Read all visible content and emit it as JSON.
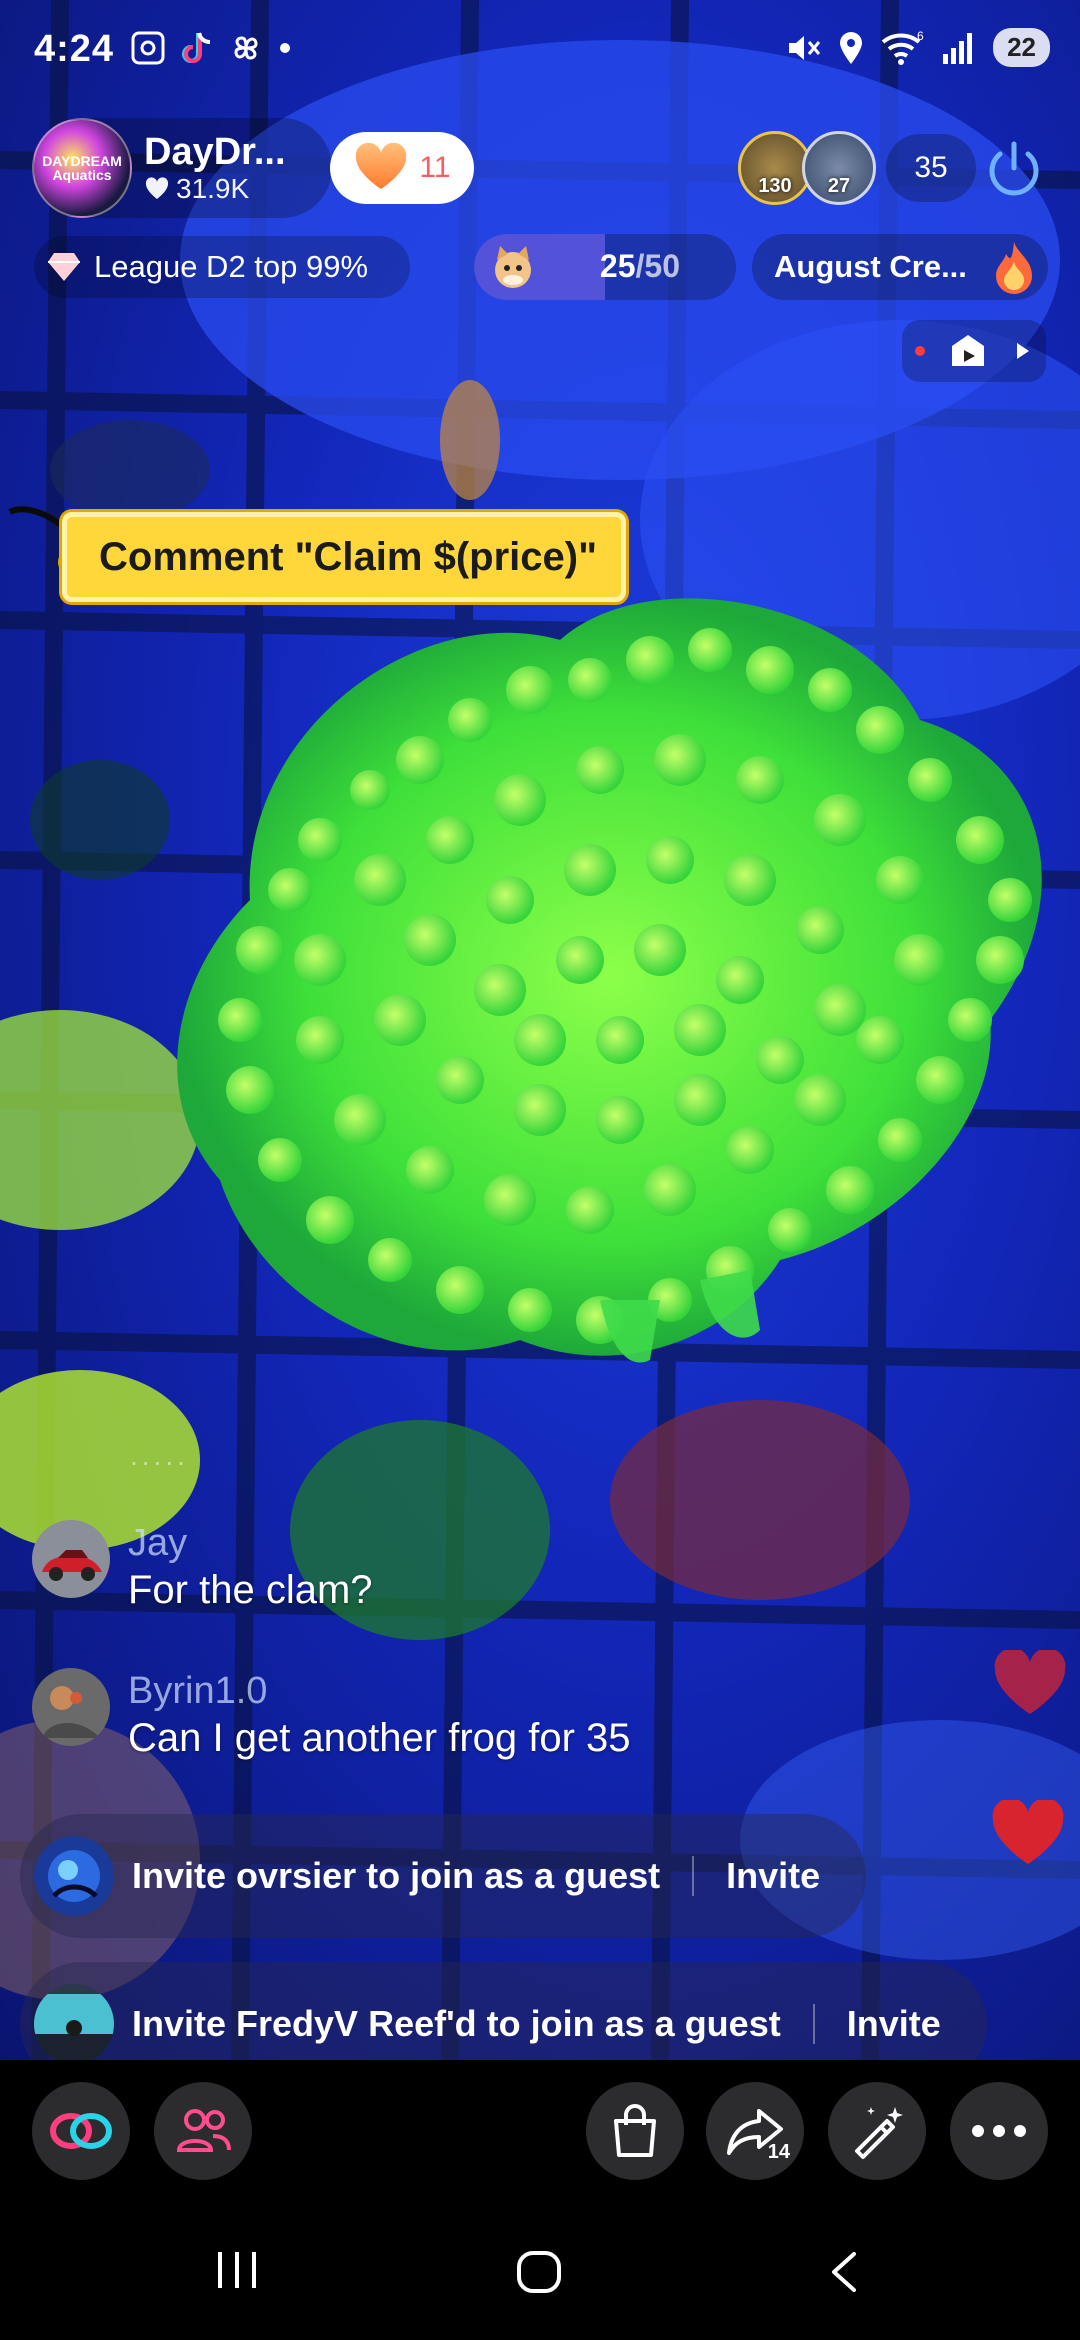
{
  "status_bar": {
    "time": "4:24",
    "battery": "22",
    "left_icons": [
      "screenshot-icon",
      "tiktok-icon",
      "pinwheel-icon",
      "dot-icon"
    ],
    "right_icons": [
      "mute-icon",
      "location-icon",
      "wifi-icon",
      "signal-icon"
    ]
  },
  "host": {
    "name": "DayDr...",
    "likes": "31.9K",
    "avatar_text": "DAYDREAM Aquatics",
    "follow_count": "11"
  },
  "viewers": {
    "avatar1_count": "130",
    "avatar2_count": "27",
    "total": "35"
  },
  "league": {
    "label": "League D2 top 99%"
  },
  "goal": {
    "current": "25",
    "separator": "/",
    "total": "50",
    "fraction": 0.5
  },
  "event": {
    "label": "August Cre..."
  },
  "product_tag": {
    "label": "Comment \"Claim $(price)\""
  },
  "comments": [
    {
      "user": "Jay",
      "text": "For the clam?"
    },
    {
      "user": "Byrin1.0",
      "text": "Can I get another frog for 35"
    }
  ],
  "invites": [
    {
      "text": "Invite ovrsier to join as a guest",
      "button": "Invite"
    },
    {
      "text": "Invite FredyV Reef'd to join as a guest",
      "button": "Invite"
    }
  ],
  "toolbar": {
    "share_count": "14",
    "buttons": [
      "link-icon",
      "multi-guest-icon",
      "shop-bag-icon",
      "share-icon",
      "magic-wand-icon",
      "more-icon"
    ]
  },
  "colors": {
    "accent_pink": "#ff3d7f",
    "accent_cyan": "#29d3e8",
    "tag_yellow": "#ffd73a",
    "heart_red": "#d8242e"
  }
}
